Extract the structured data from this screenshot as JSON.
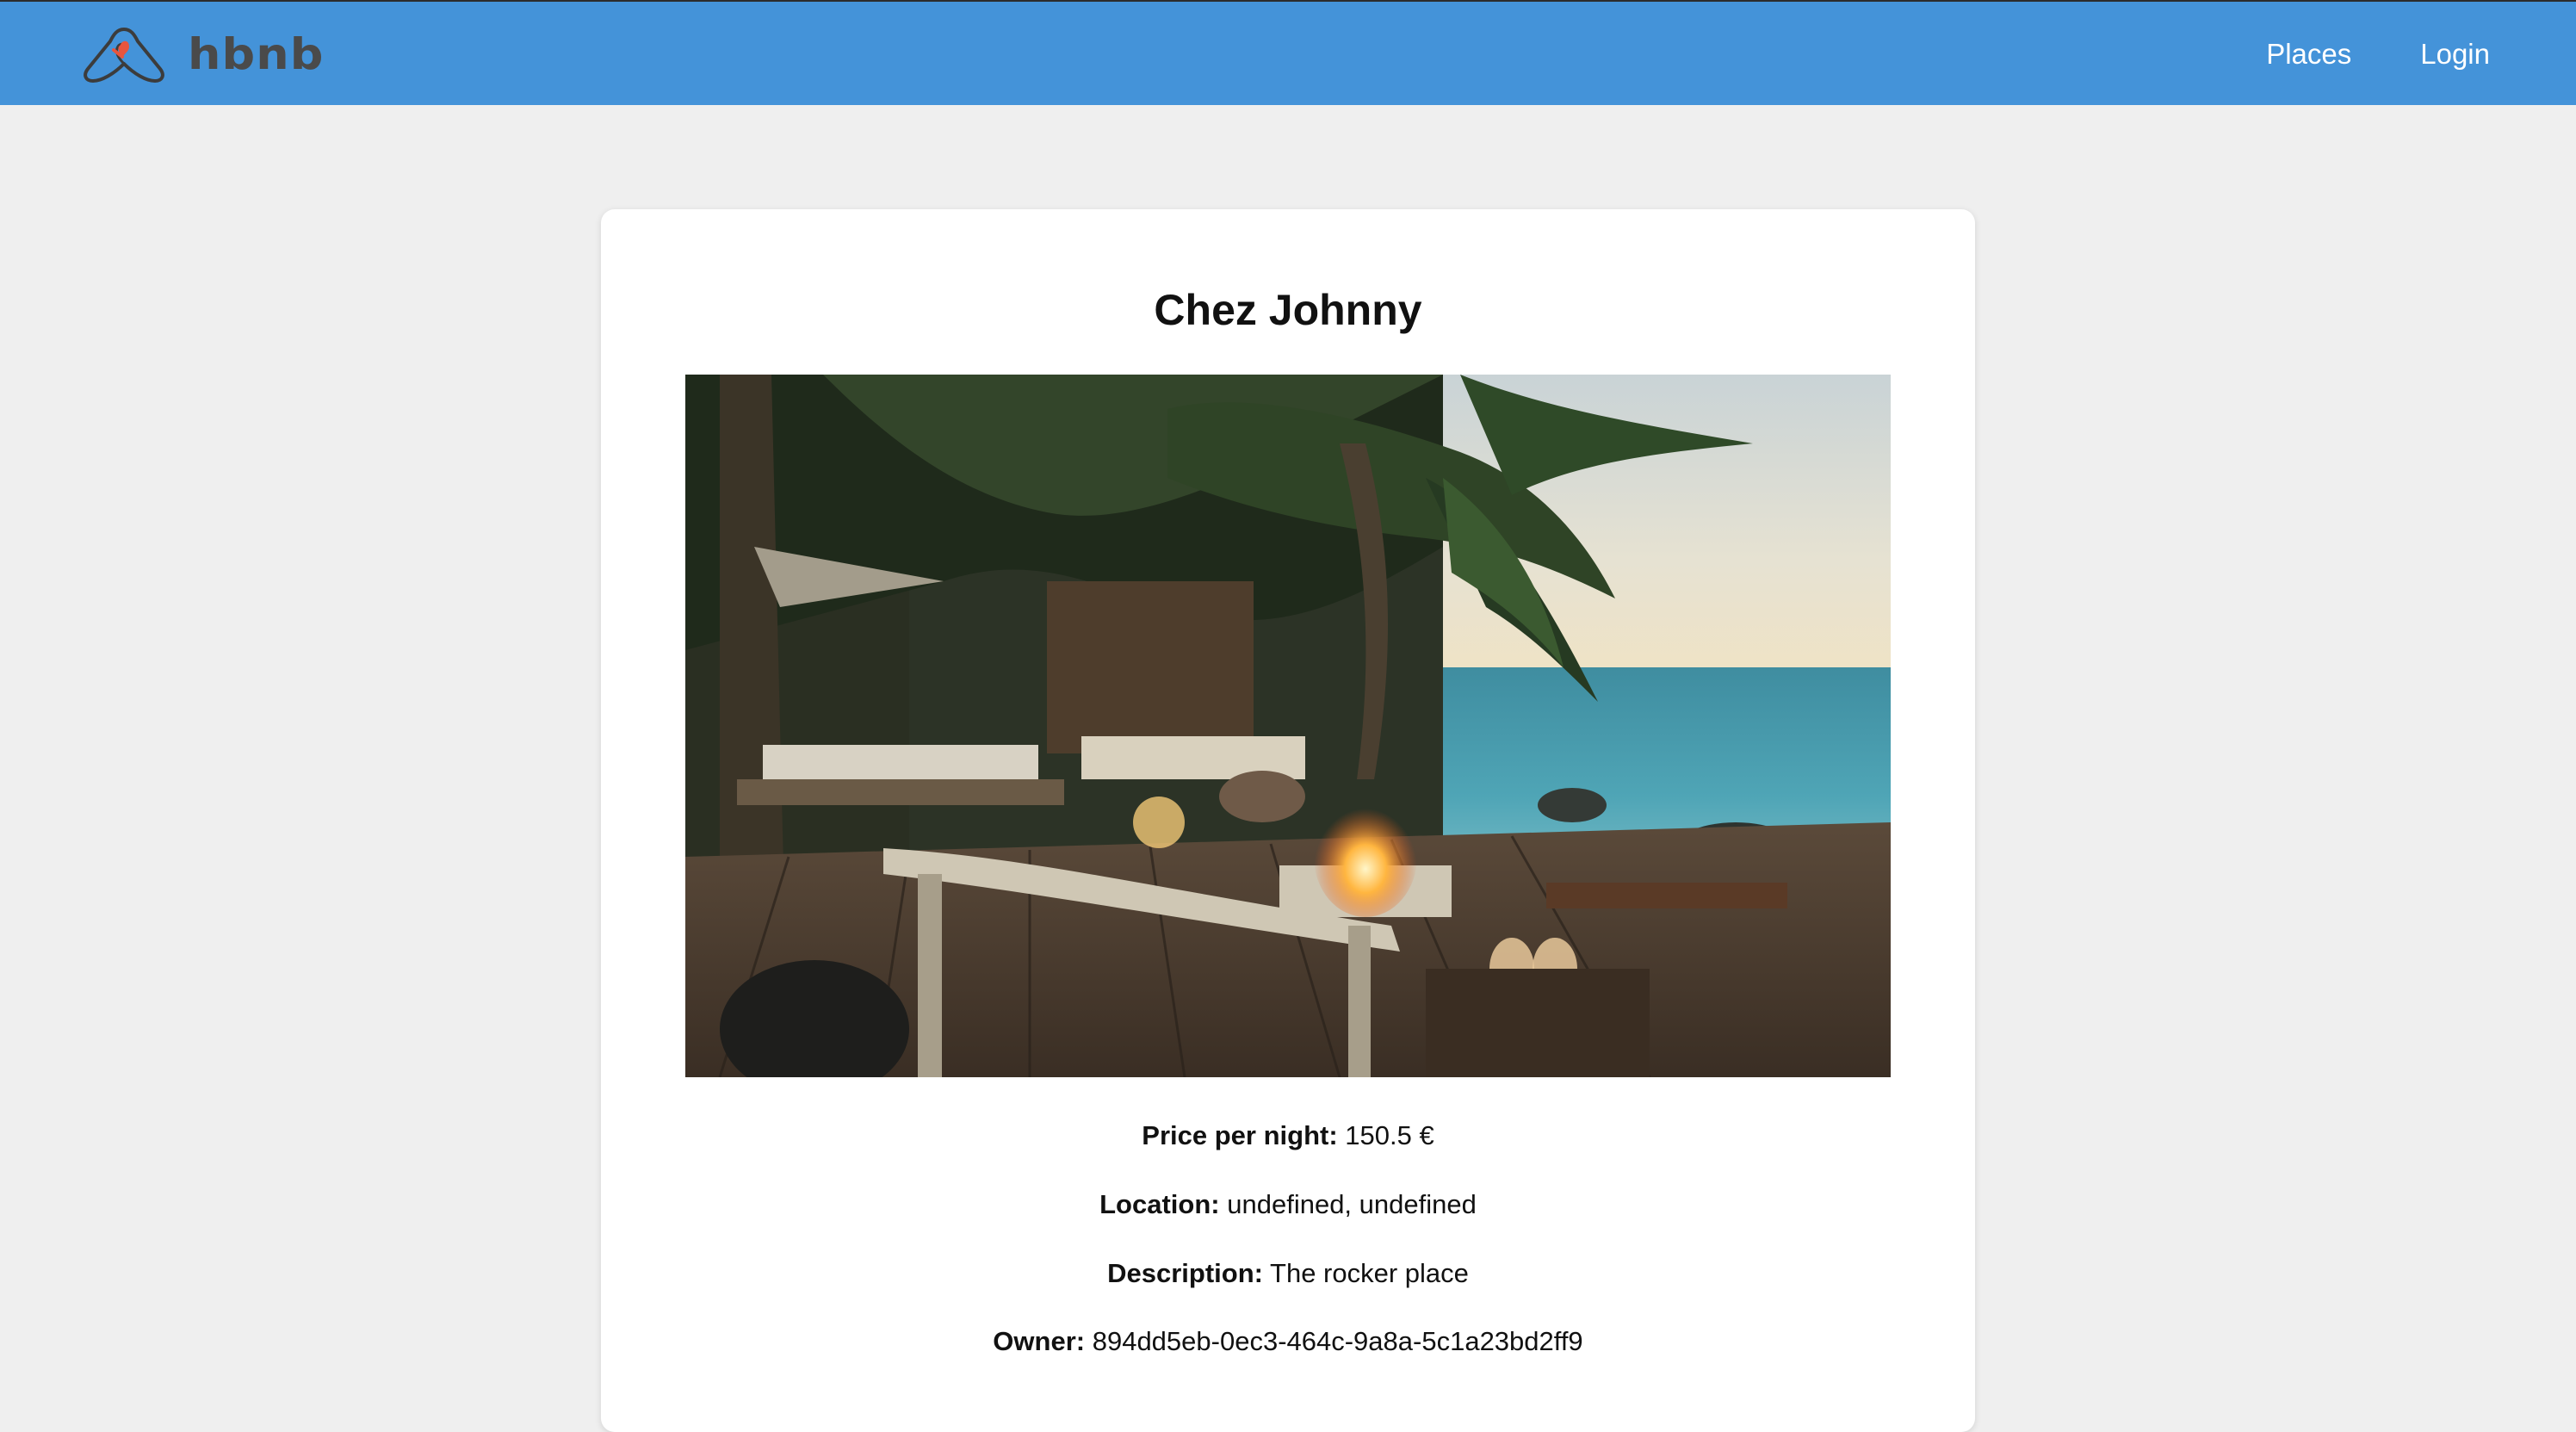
{
  "header": {
    "logo_text": "hbnb",
    "nav": [
      {
        "label": "Places"
      },
      {
        "label": "Login"
      }
    ]
  },
  "place": {
    "title": "Chez Johnny",
    "price": {
      "label": "Price per night:",
      "value": "150.5 €"
    },
    "location": {
      "label": "Location:",
      "value": "undefined, undefined"
    },
    "description": {
      "label": "Description:",
      "value": "The rocker place"
    },
    "owner": {
      "label": "Owner:",
      "value": "894dd5eb-0ec3-464c-9a8a-5c1a23bd2ff9"
    }
  },
  "colors": {
    "header_bg": "#4493d9",
    "page_bg": "#efefef",
    "card_bg": "#ffffff",
    "logo_accent": "#e8553e"
  }
}
